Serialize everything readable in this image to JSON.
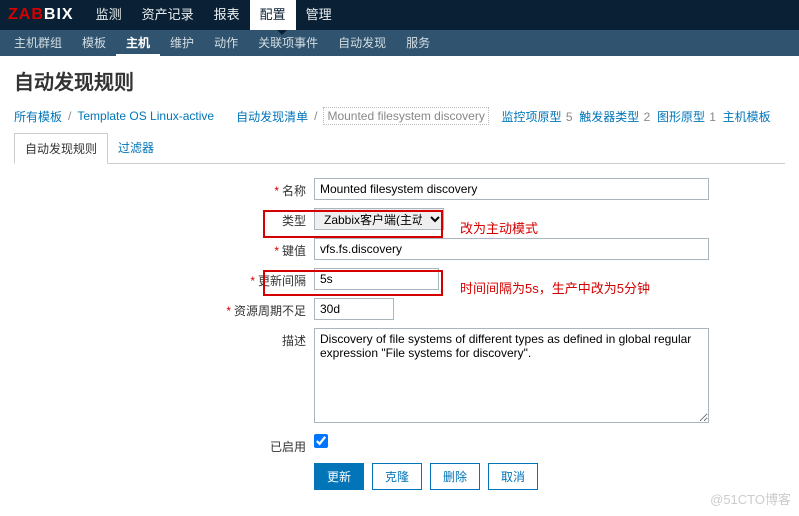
{
  "logo": {
    "part1": "ZAB",
    "part2": "BIX"
  },
  "topnav": {
    "items": [
      "监测",
      "资产记录",
      "报表",
      "配置",
      "管理"
    ],
    "active_index": 3
  },
  "subnav": {
    "items": [
      "主机群组",
      "模板",
      "主机",
      "维护",
      "动作",
      "关联项事件",
      "自动发现",
      "服务"
    ],
    "active_index": 2
  },
  "page_title": "自动发现规则",
  "breadcrumb": {
    "all_templates": "所有模板",
    "template": "Template OS Linux-active",
    "discovery_list": "自动发现清单",
    "current": "Mounted filesystem discovery",
    "links": [
      {
        "label": "监控项原型",
        "count": 5
      },
      {
        "label": "触发器类型",
        "count": 2
      },
      {
        "label": "图形原型",
        "count": 1
      },
      {
        "label": "主机模板",
        "count": null
      }
    ]
  },
  "tabs": {
    "items": [
      "自动发现规则",
      "过滤器"
    ],
    "active_index": 0
  },
  "form": {
    "name_label": "名称",
    "name_value": "Mounted filesystem discovery",
    "type_label": "类型",
    "type_value": "Zabbix客户端(主动式)",
    "key_label": "键值",
    "key_value": "vfs.fs.discovery",
    "interval_label": "更新间隔",
    "interval_value": "5s",
    "resource_label": "资源周期不足",
    "resource_value": "30d",
    "desc_label": "描述",
    "desc_value": "Discovery of file systems of different types as defined in global regular expression \"File systems for discovery\".",
    "enabled_label": "已启用",
    "enabled_checked": true
  },
  "annotations": {
    "type_note": "改为主动模式",
    "interval_note": "时间间隔为5s，生产中改为5分钟"
  },
  "buttons": {
    "update": "更新",
    "clone": "克隆",
    "delete": "删除",
    "cancel": "取消"
  },
  "watermark": "@51CTO博客"
}
